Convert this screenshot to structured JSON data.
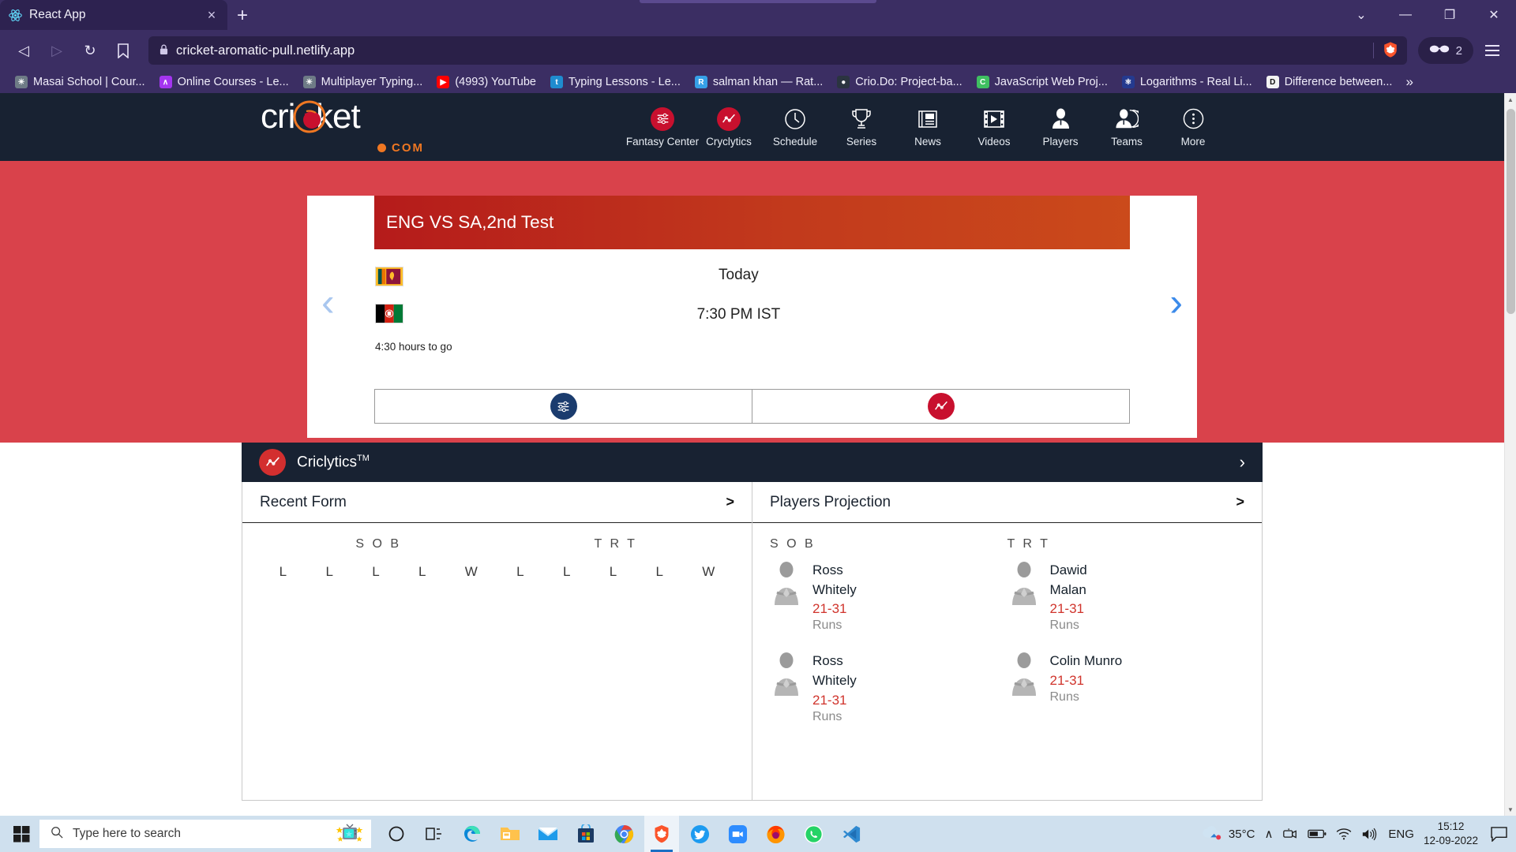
{
  "browser": {
    "tab": {
      "title": "React App",
      "favicon": "react-icon",
      "close": "×"
    },
    "newtab_label": "+",
    "window": {
      "minimize": "—",
      "maximize": "❐",
      "close": "✕",
      "chevron": "⌄"
    },
    "nav": {
      "back": "◁",
      "forward": "▷",
      "reload": "↻",
      "bookmark": "☆"
    },
    "omnibox": {
      "url": "cricket-aromatic-pull.netlify.app",
      "lock": "lock-icon"
    },
    "shields": {
      "count": "2",
      "icon": "brave-shields-icon"
    },
    "menu_icon": "hamburger-menu-icon",
    "bookmarks": [
      {
        "label": "Masai School | Cour...",
        "icon": "globe-icon",
        "color": "#6e7b86",
        "glyph": "◔"
      },
      {
        "label": "Online Courses - Le...",
        "icon": "udemy-icon",
        "color": "#a435f0",
        "glyph": "Û"
      },
      {
        "label": "Multiplayer Typing...",
        "icon": "globe-icon",
        "color": "#6e7b86",
        "glyph": "◔"
      },
      {
        "label": "(4993) YouTube",
        "icon": "youtube-icon",
        "color": "#ff0000",
        "glyph": "▶"
      },
      {
        "label": "Typing Lessons - Le...",
        "icon": "typing-icon",
        "color": "#1f8ccf",
        "glyph": "t"
      },
      {
        "label": "salman khan — Rat...",
        "icon": "slack-icon",
        "color": "#36a0e8",
        "glyph": "R"
      },
      {
        "label": "Crio.Do: Project-ba...",
        "icon": "crio-icon",
        "color": "#2b3440",
        "glyph": "●"
      },
      {
        "label": "JavaScript Web Proj...",
        "icon": "js-icon",
        "color": "#3fbf61",
        "glyph": "C"
      },
      {
        "label": "Logarithms - Real Li...",
        "icon": "atom-icon",
        "color": "#243a8f",
        "glyph": "⚛"
      },
      {
        "label": "Difference between...",
        "icon": "letter-d-icon",
        "color": "#f2f2f2",
        "glyph": "D"
      }
    ],
    "bookmarks_overflow": "»"
  },
  "site": {
    "logo": {
      "word": "cricket",
      "com": "COM"
    },
    "nav_items": [
      {
        "label": "Fantasy Center",
        "icon": "sliders-icon",
        "highlighted": true
      },
      {
        "label": "Cryclytics",
        "icon": "analytics-icon",
        "highlighted": true
      },
      {
        "label": "Schedule",
        "icon": "clock-icon",
        "highlighted": false
      },
      {
        "label": "Series",
        "icon": "trophy-icon",
        "highlighted": false
      },
      {
        "label": "News",
        "icon": "newspaper-icon",
        "highlighted": false
      },
      {
        "label": "Videos",
        "icon": "video-icon",
        "highlighted": false
      },
      {
        "label": "Players",
        "icon": "player-icon",
        "highlighted": false
      },
      {
        "label": "Teams",
        "icon": "teams-icon",
        "highlighted": false
      },
      {
        "label": "More",
        "icon": "more-dots-icon",
        "highlighted": false
      }
    ]
  },
  "match_card": {
    "title": "ENG VS SA,2nd Test",
    "team_a_flag": "sri-lanka-flag",
    "team_b_flag": "afghanistan-flag",
    "hours_to_go": "4:30 hours to go",
    "day": "Today",
    "time": "7:30 PM IST",
    "prev_arrow": "‹",
    "next_arrow": "›",
    "buttons": [
      {
        "icon": "fantasy-sliders-icon",
        "color": "#1b3c6e"
      },
      {
        "icon": "criclytics-graph-icon",
        "color": "#c8102e"
      }
    ]
  },
  "criclytics": {
    "title": "Criclytics",
    "trademark": "TM",
    "badge_icon": "criclytics-graph-icon",
    "chevron": "›"
  },
  "recent_form": {
    "title": "Recent Form",
    "arrow": ">",
    "teams": [
      {
        "name": "S O B",
        "results": [
          "L",
          "L",
          "L",
          "L",
          "W"
        ]
      },
      {
        "name": "T R T",
        "results": [
          "L",
          "L",
          "L",
          "L",
          "W"
        ]
      }
    ]
  },
  "players_projection": {
    "title": "Players Projection",
    "arrow": ">",
    "columns": [
      {
        "team": "S O B",
        "players": [
          {
            "name": "Ross Whitely",
            "range": "21-31",
            "unit": "Runs",
            "avatar": "player-avatar"
          },
          {
            "name": "Ross Whitely",
            "range": "21-31",
            "unit": "Runs",
            "avatar": "player-avatar"
          }
        ]
      },
      {
        "team": "T R T",
        "players": [
          {
            "name": "Dawid Malan",
            "range": "21-31",
            "unit": "Runs",
            "avatar": "player-avatar"
          },
          {
            "name": "Colin Munro",
            "range": "21-31",
            "unit": "Runs",
            "avatar": "player-avatar"
          }
        ]
      }
    ]
  },
  "taskbar": {
    "start_icon": "windows-start-icon",
    "search_placeholder": "Type here to search",
    "search_widget_icon": "tv-stars-icon",
    "apps": [
      {
        "name": "cortana-icon",
        "glyph": "○",
        "active": false
      },
      {
        "name": "task-view-icon",
        "glyph": "⧉",
        "active": false
      },
      {
        "name": "edge-icon",
        "glyph": "",
        "active": false
      },
      {
        "name": "file-explorer-icon",
        "glyph": "",
        "active": false
      },
      {
        "name": "mail-icon",
        "glyph": "",
        "active": false
      },
      {
        "name": "microsoft-store-icon",
        "glyph": "",
        "active": false
      },
      {
        "name": "chrome-icon",
        "glyph": "",
        "active": false
      },
      {
        "name": "brave-icon",
        "glyph": "",
        "active": true
      },
      {
        "name": "twitter-icon",
        "glyph": "",
        "active": false
      },
      {
        "name": "zoom-icon",
        "glyph": "",
        "active": false
      },
      {
        "name": "firefox-icon",
        "glyph": "",
        "active": false
      },
      {
        "name": "whatsapp-icon",
        "glyph": "",
        "active": false
      },
      {
        "name": "vscode-icon",
        "glyph": "",
        "active": false
      }
    ],
    "tray": {
      "weather_temp": "35°C",
      "weather_icon": "cloud-icon",
      "chevron_up": "∧",
      "meet_icon": "meeting-icon",
      "battery_icon": "battery-icon",
      "wifi_icon": "wifi-icon",
      "volume_icon": "volume-icon",
      "language": "ENG",
      "time": "15:12",
      "date": "12-09-2022",
      "notification_icon": "action-center-icon"
    }
  },
  "colors": {
    "brave_purple": "#3b2e63",
    "site_dark": "#182232",
    "hero_red": "#d9424b",
    "accent_red": "#c8102e",
    "orange": "#ef7722",
    "projection_red": "#d0342c"
  }
}
